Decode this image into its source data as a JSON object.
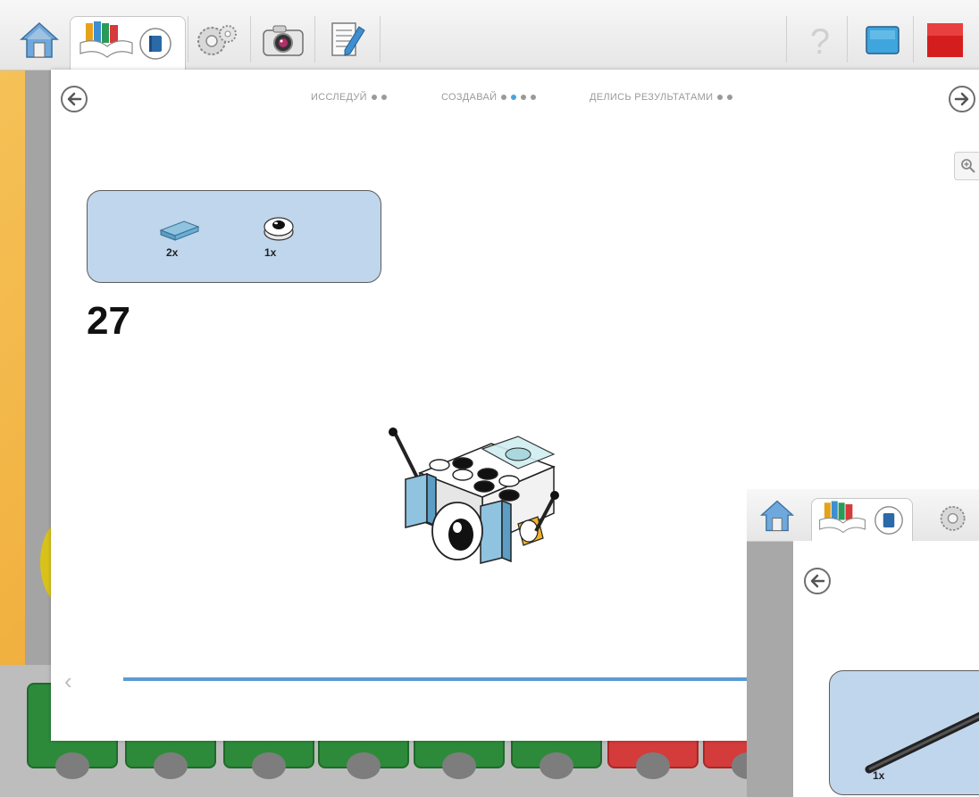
{
  "toolbar": {
    "tabs": [
      {
        "name": "home-tab",
        "icon": "home-icon"
      },
      {
        "name": "library-tab",
        "icon": "books-icon",
        "active": true
      },
      {
        "name": "tools-tab",
        "icon": "gears-icon"
      },
      {
        "name": "camera-tab",
        "icon": "camera-icon"
      },
      {
        "name": "notes-tab",
        "icon": "notepad-icon"
      }
    ],
    "right_icons": [
      "help-icon",
      "blue-screen-icon",
      "red-stop-icon"
    ]
  },
  "nav": {
    "steps": [
      {
        "label": "ИССЛЕДУЙ",
        "dots": 2,
        "active_dot": -1
      },
      {
        "label": "СОЗДАВАЙ",
        "dots": 4,
        "active_dot": 1
      },
      {
        "label": "ДЕЛИСЬ РЕЗУЛЬТАТАМИ",
        "dots": 2,
        "active_dot": -1
      }
    ]
  },
  "instructions": {
    "parts": [
      {
        "qty": "2x",
        "part": "flat-tile-blue"
      },
      {
        "qty": "1x",
        "part": "eye-round-tile"
      }
    ],
    "step_number": "27"
  },
  "overlay": {
    "parts": [
      {
        "qty": "1x",
        "part": "black-axle"
      }
    ]
  },
  "colors": {
    "accent_blue": "#4aa3df",
    "parts_box_bg": "#c0d6ec",
    "block_green": "#2d8a3a",
    "block_red": "#d43b3b",
    "frame_orange": "#f0ad3a"
  }
}
